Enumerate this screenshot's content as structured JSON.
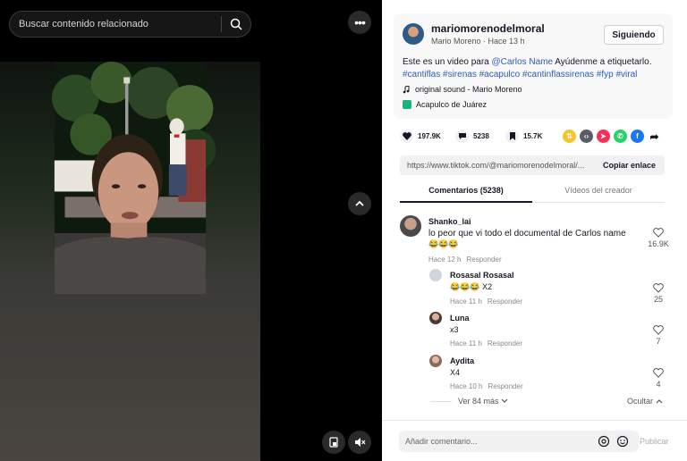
{
  "search": {
    "placeholder": "Buscar contenido relacionado"
  },
  "video": {
    "actions_more_label": "•••"
  },
  "author": {
    "username": "mariomorenodelmoral",
    "subline": "Mario Moreno · Hace 13 h",
    "follow_label": "Siguiendo"
  },
  "description": {
    "text": "Este es un video para",
    "mention": "@Carlos Name",
    "text2": "Ayúdenme a etiquetarlo.",
    "hashtags": "#cantiflas #sirenas #acapulco #cantinflassirenas #fyp #viral"
  },
  "sound": {
    "label": "original sound - Mario Moreno"
  },
  "location": {
    "label": "Acapulco de Juárez"
  },
  "stats": {
    "likes": "197.9K",
    "comments": "5238",
    "saves": "15.7K"
  },
  "share_icons": [
    "repost-icon",
    "embed-icon",
    "send-icon",
    "whatsapp-icon",
    "facebook-icon",
    "share-arrow-icon"
  ],
  "link": {
    "url": "https://www.tiktok.com/@mariomorenodelmoral/...",
    "copy_label": "Copiar enlace"
  },
  "tabs": {
    "comments": "Comentarios (5238)",
    "creator_videos": "Vídeos del creador"
  },
  "comments": [
    {
      "user": "Shanko_lai",
      "text": "lo peor que vi todo el documental de Carlos name",
      "emoji": "😂😂😂",
      "time": "Hace 12 h",
      "reply": "Responder",
      "likes": "16.9K"
    },
    {
      "user": "Rosasal Rosasal",
      "text": "😂😂😂 X2",
      "time": "Hace 11 h",
      "reply": "Responder",
      "likes": "25"
    },
    {
      "user": "Luna",
      "text": "x3",
      "time": "Hace 11 h",
      "reply": "Responder",
      "likes": "7"
    },
    {
      "user": "Aydita",
      "text": "X4",
      "time": "Hace 10 h",
      "reply": "Responder",
      "likes": "4"
    }
  ],
  "thread": {
    "more_label": "Ver 84 más",
    "hide_label": "Ocultar"
  },
  "composer": {
    "placeholder": "Añadir comentario...",
    "publish_label": "Publicar"
  }
}
